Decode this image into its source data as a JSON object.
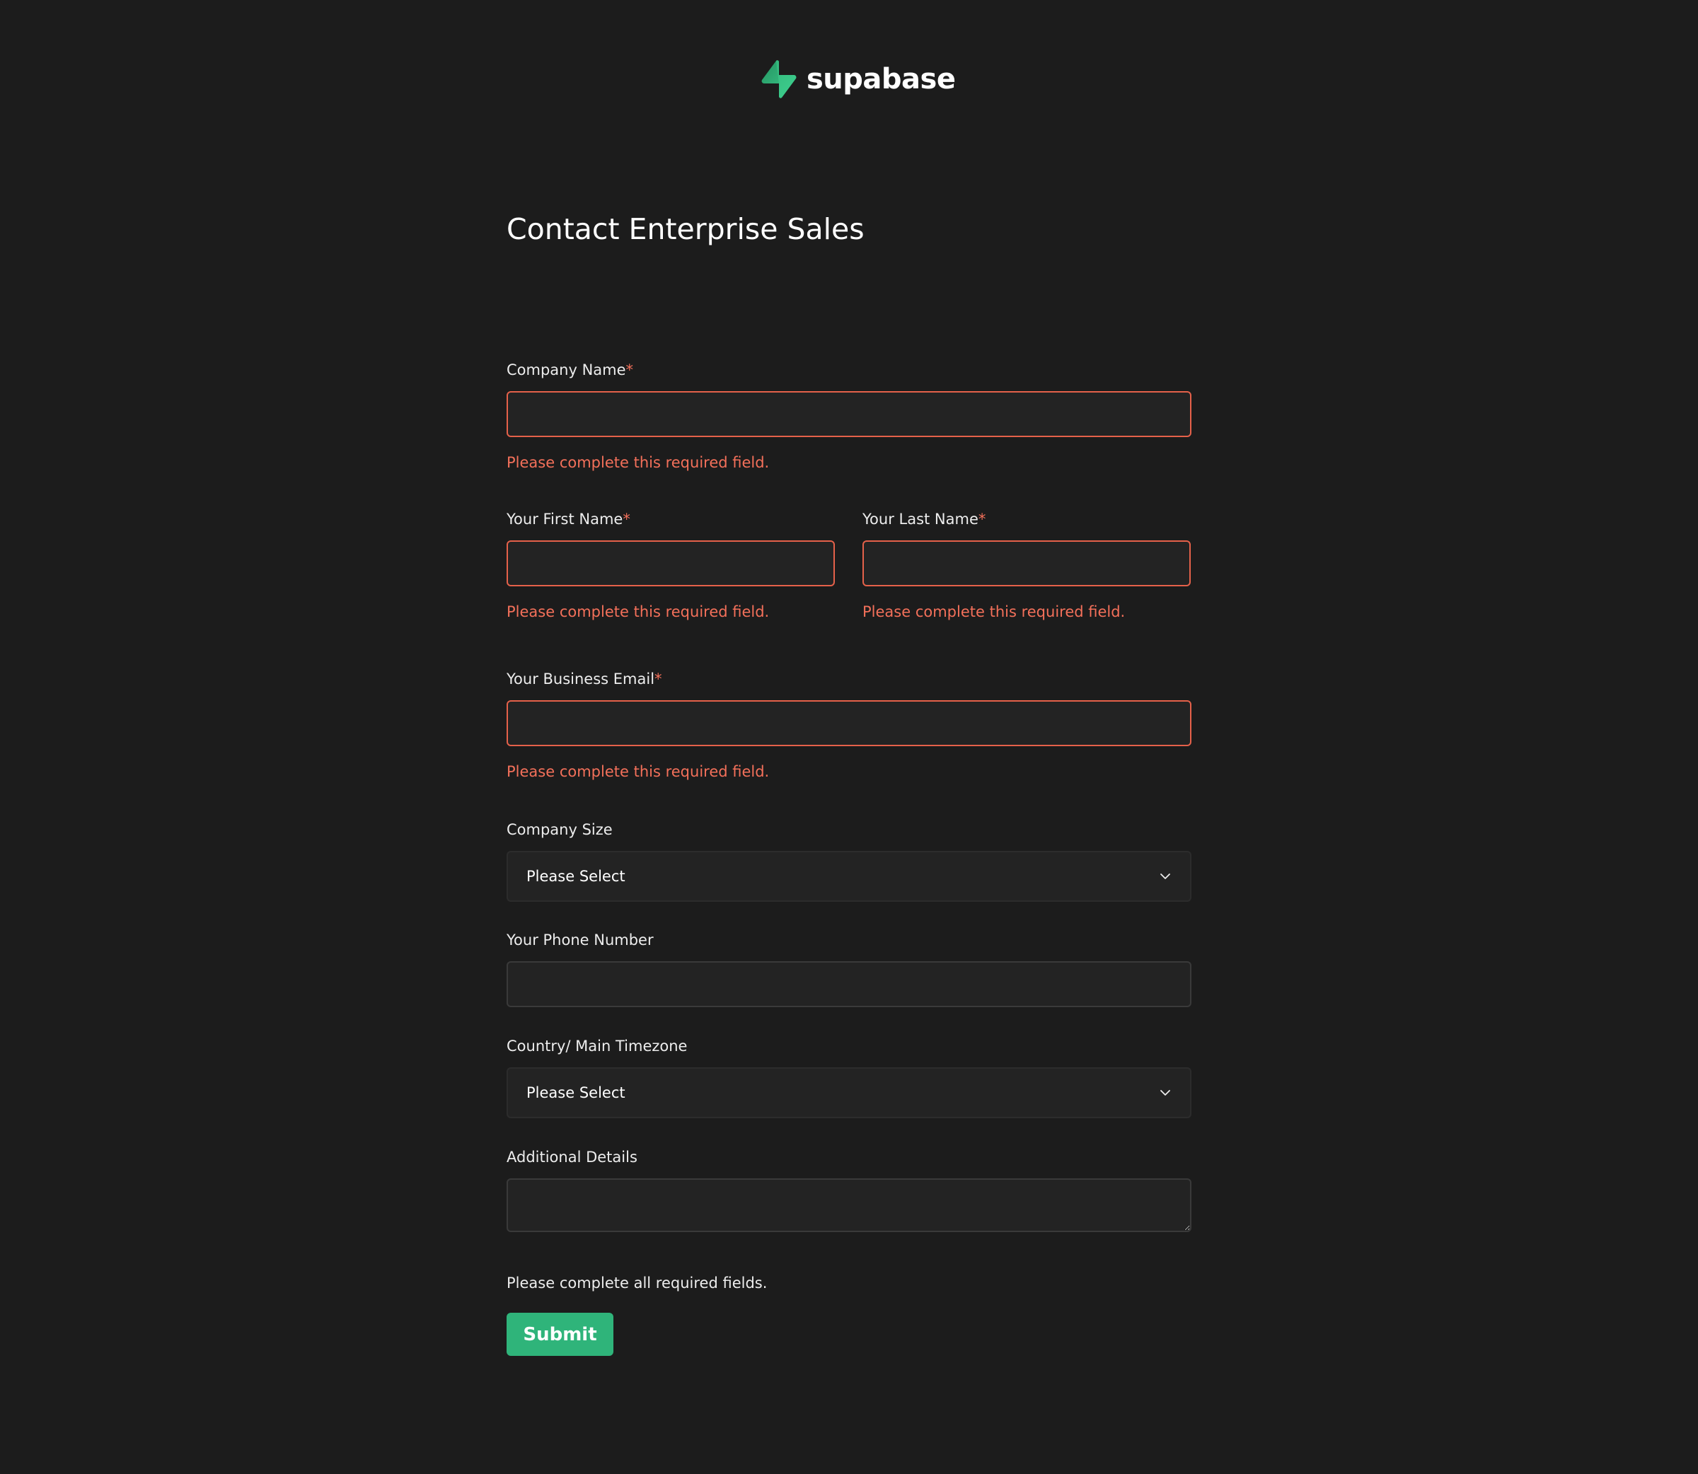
{
  "brand": {
    "name": "supabase",
    "logo_icon": "bolt-icon",
    "accent_color": "#3ecf8e"
  },
  "form": {
    "title": "Contact Enterprise Sales",
    "required_marker": "*",
    "error_message": "Please complete this required field.",
    "fields": {
      "company_name": {
        "label": "Company Name",
        "value": ""
      },
      "first_name": {
        "label": "Your First Name",
        "value": ""
      },
      "last_name": {
        "label": "Your Last Name",
        "value": ""
      },
      "business_email": {
        "label": "Your Business Email",
        "value": ""
      },
      "company_size": {
        "label": "Company Size",
        "selected": "Please Select"
      },
      "phone_number": {
        "label": "Your Phone Number",
        "value": ""
      },
      "country_timezone": {
        "label": "Country/ Main Timezone",
        "selected": "Please Select"
      },
      "additional_details": {
        "label": "Additional Details",
        "value": ""
      }
    },
    "summary_message": "Please complete all required fields.",
    "submit_label": "Submit"
  },
  "colors": {
    "background": "#1c1c1c",
    "input_background": "#232323",
    "error": "#f3705a",
    "button": "#2fb47a"
  }
}
